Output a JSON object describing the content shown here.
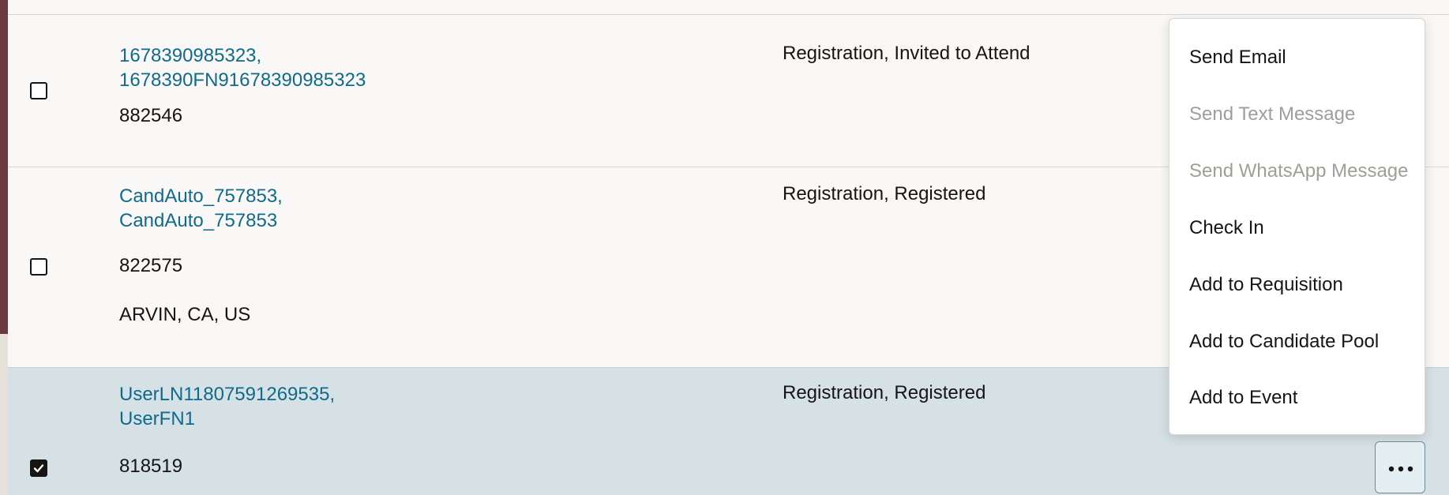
{
  "rows": [
    {
      "name_line1": "1678390985323,",
      "name_line2": "1678390FN91678390985323",
      "id": "882546",
      "location": "",
      "status": "Registration, Invited to Attend",
      "checked": false
    },
    {
      "name_line1": "CandAuto_757853,",
      "name_line2": "CandAuto_757853",
      "id": "822575",
      "location": "ARVIN, CA, US",
      "status": "Registration, Registered",
      "checked": false
    },
    {
      "name_line1": "UserLN11807591269535,",
      "name_line2": "UserFN1",
      "id": "818519",
      "location": "",
      "status": "Registration, Registered",
      "checked": true
    }
  ],
  "menu": {
    "items": [
      {
        "label": "Send Email",
        "enabled": true
      },
      {
        "label": "Send Text Message",
        "enabled": false
      },
      {
        "label": "Send WhatsApp Message",
        "enabled": false
      },
      {
        "label": "Check In",
        "enabled": true
      },
      {
        "label": "Add to Requisition",
        "enabled": true
      },
      {
        "label": "Add to Candidate Pool",
        "enabled": true
      },
      {
        "label": "Add to Event",
        "enabled": true
      }
    ]
  },
  "more_button": {
    "icon": "more-actions-icon"
  },
  "colors": {
    "link": "#0f6a8c",
    "selected_row": "#d6e1e6",
    "row_bg": "#faf8f6",
    "disabled_text": "#a19d98",
    "accent_stripe": "#6b3a43"
  }
}
